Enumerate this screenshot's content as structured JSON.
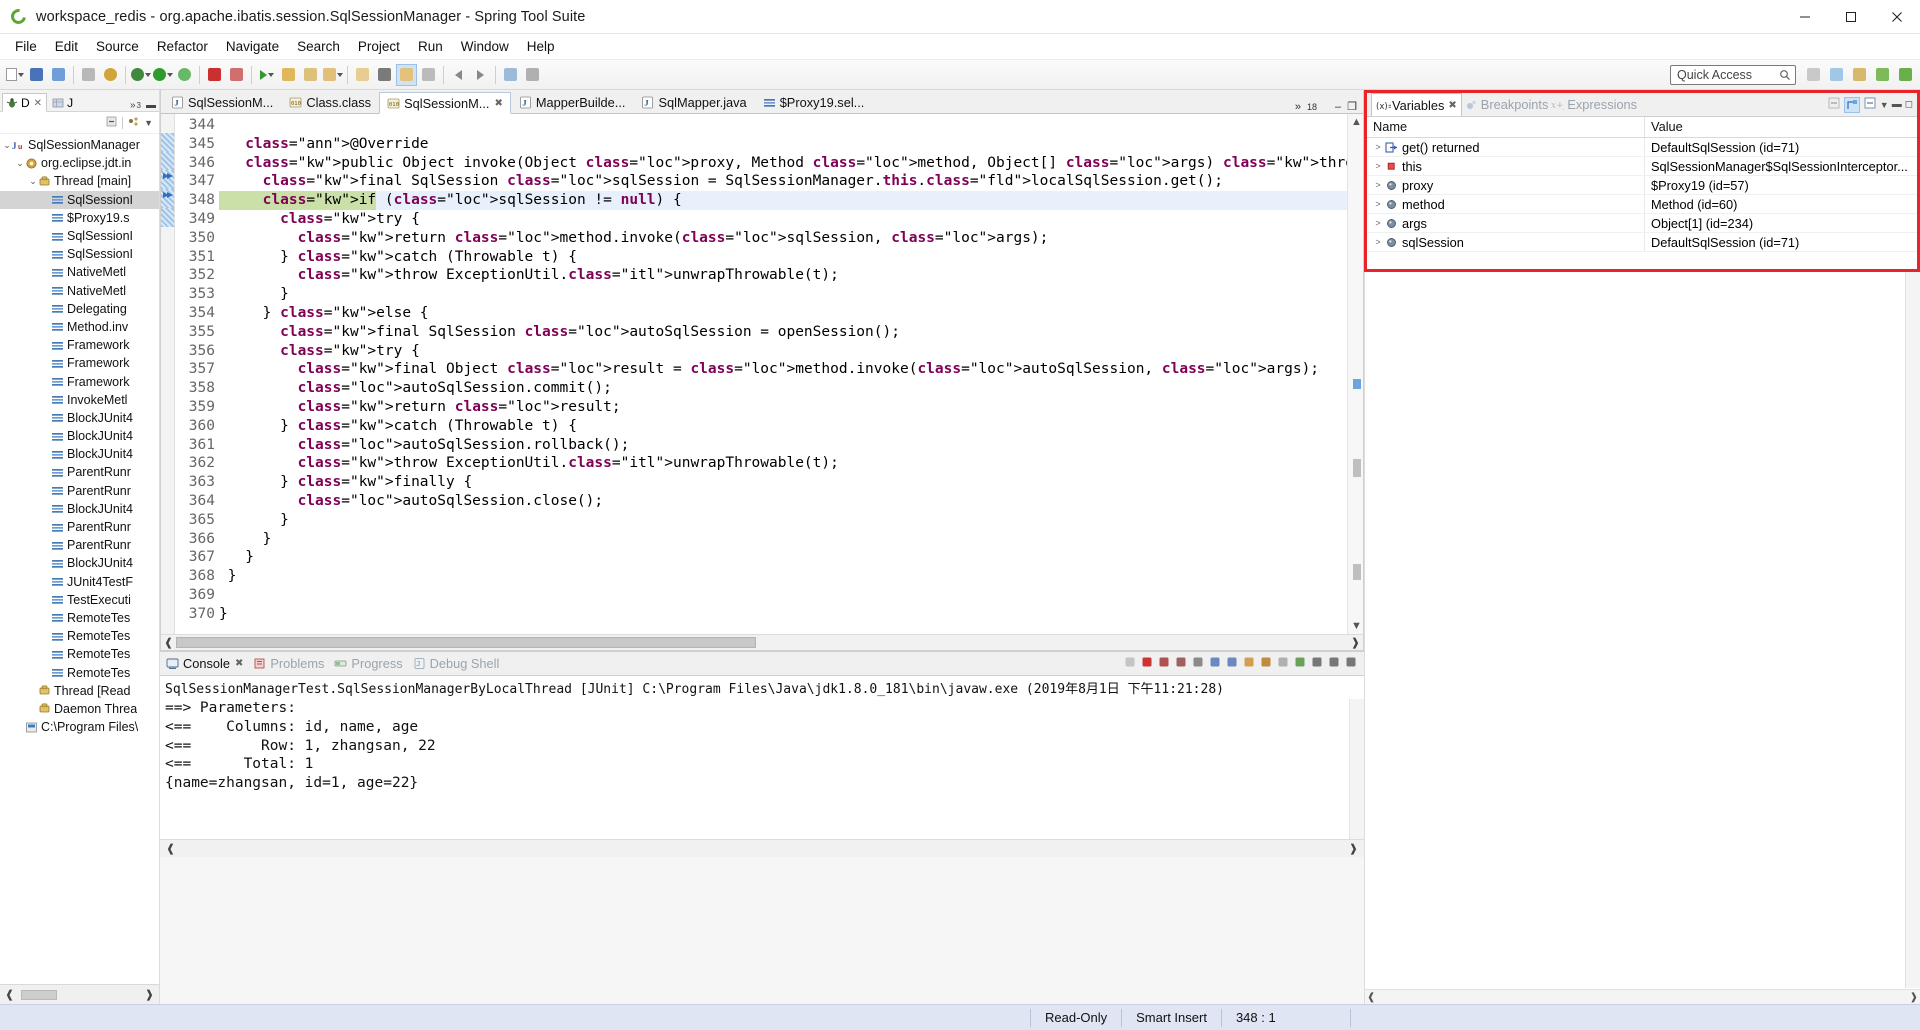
{
  "window": {
    "title": "workspace_redis - org.apache.ibatis.session.SqlSessionManager - Spring Tool Suite",
    "app_icon": "sts-icon",
    "minimize": "–",
    "maximize": "□",
    "close": "✕"
  },
  "menu": {
    "items": [
      "File",
      "Edit",
      "Source",
      "Refactor",
      "Navigate",
      "Search",
      "Project",
      "Run",
      "Window",
      "Help"
    ]
  },
  "toolbar": {
    "quick_access_placeholder": "Quick Access",
    "quick_access_value": ""
  },
  "debug_view": {
    "tab_label": "D",
    "tab_close": "✕",
    "secondary_tab": "J",
    "overflow": "»",
    "overflow_count": "3",
    "tree": [
      {
        "indent": 0,
        "twisty": "⌄",
        "icon": "junit-icon",
        "label": "SqlSessionManager",
        "selected": false
      },
      {
        "indent": 1,
        "twisty": "⌄",
        "icon": "process-icon",
        "label": "org.eclipse.jdt.in",
        "selected": false
      },
      {
        "indent": 2,
        "twisty": "⌄",
        "icon": "thread-icon",
        "label": "Thread [main]",
        "selected": false
      },
      {
        "indent": 3,
        "twisty": "",
        "icon": "stackframe-icon",
        "label": "SqlSessionI",
        "selected": true
      },
      {
        "indent": 3,
        "twisty": "",
        "icon": "stackframe-icon",
        "label": "$Proxy19.s",
        "selected": false
      },
      {
        "indent": 3,
        "twisty": "",
        "icon": "stackframe-icon",
        "label": "SqlSessionI",
        "selected": false
      },
      {
        "indent": 3,
        "twisty": "",
        "icon": "stackframe-icon",
        "label": "SqlSessionI",
        "selected": false
      },
      {
        "indent": 3,
        "twisty": "",
        "icon": "stackframe-icon",
        "label": "NativeMetl",
        "selected": false
      },
      {
        "indent": 3,
        "twisty": "",
        "icon": "stackframe-icon",
        "label": "NativeMetl",
        "selected": false
      },
      {
        "indent": 3,
        "twisty": "",
        "icon": "stackframe-icon",
        "label": "Delegating",
        "selected": false
      },
      {
        "indent": 3,
        "twisty": "",
        "icon": "stackframe-icon",
        "label": "Method.inv",
        "selected": false
      },
      {
        "indent": 3,
        "twisty": "",
        "icon": "stackframe-icon",
        "label": "Framework",
        "selected": false
      },
      {
        "indent": 3,
        "twisty": "",
        "icon": "stackframe-icon",
        "label": "Framework",
        "selected": false
      },
      {
        "indent": 3,
        "twisty": "",
        "icon": "stackframe-icon",
        "label": "Framework",
        "selected": false
      },
      {
        "indent": 3,
        "twisty": "",
        "icon": "stackframe-icon",
        "label": "InvokeMetl",
        "selected": false
      },
      {
        "indent": 3,
        "twisty": "",
        "icon": "stackframe-icon",
        "label": "BlockJUnit4",
        "selected": false
      },
      {
        "indent": 3,
        "twisty": "",
        "icon": "stackframe-icon",
        "label": "BlockJUnit4",
        "selected": false
      },
      {
        "indent": 3,
        "twisty": "",
        "icon": "stackframe-icon",
        "label": "BlockJUnit4",
        "selected": false
      },
      {
        "indent": 3,
        "twisty": "",
        "icon": "stackframe-icon",
        "label": "ParentRunr",
        "selected": false
      },
      {
        "indent": 3,
        "twisty": "",
        "icon": "stackframe-icon",
        "label": "ParentRunr",
        "selected": false
      },
      {
        "indent": 3,
        "twisty": "",
        "icon": "stackframe-icon",
        "label": "BlockJUnit4",
        "selected": false
      },
      {
        "indent": 3,
        "twisty": "",
        "icon": "stackframe-icon",
        "label": "ParentRunr",
        "selected": false
      },
      {
        "indent": 3,
        "twisty": "",
        "icon": "stackframe-icon",
        "label": "ParentRunr",
        "selected": false
      },
      {
        "indent": 3,
        "twisty": "",
        "icon": "stackframe-icon",
        "label": "BlockJUnit4",
        "selected": false
      },
      {
        "indent": 3,
        "twisty": "",
        "icon": "stackframe-icon",
        "label": "JUnit4TestF",
        "selected": false
      },
      {
        "indent": 3,
        "twisty": "",
        "icon": "stackframe-icon",
        "label": "TestExecuti",
        "selected": false
      },
      {
        "indent": 3,
        "twisty": "",
        "icon": "stackframe-icon",
        "label": "RemoteTes",
        "selected": false
      },
      {
        "indent": 3,
        "twisty": "",
        "icon": "stackframe-icon",
        "label": "RemoteTes",
        "selected": false
      },
      {
        "indent": 3,
        "twisty": "",
        "icon": "stackframe-icon",
        "label": "RemoteTes",
        "selected": false
      },
      {
        "indent": 3,
        "twisty": "",
        "icon": "stackframe-icon",
        "label": "RemoteTes",
        "selected": false
      },
      {
        "indent": 2,
        "twisty": "",
        "icon": "thread-icon",
        "label": "Thread [Read",
        "selected": false
      },
      {
        "indent": 2,
        "twisty": "",
        "icon": "thread-icon",
        "label": "Daemon Threa",
        "selected": false
      },
      {
        "indent": 1,
        "twisty": "",
        "icon": "exe-icon",
        "label": "C:\\Program Files\\",
        "selected": false
      }
    ]
  },
  "editor": {
    "tabs": [
      {
        "label": "SqlSessionM...",
        "icon": "java-icon",
        "state": "inactive",
        "closable": false
      },
      {
        "label": "Class.class",
        "icon": "class-icon",
        "state": "inactive",
        "closable": false
      },
      {
        "label": "SqlSessionM...",
        "icon": "class-icon",
        "state": "active",
        "closable": true
      },
      {
        "label": "MapperBuilde...",
        "icon": "java-icon",
        "state": "inactive",
        "closable": false
      },
      {
        "label": "SqlMapper.java",
        "icon": "java-icon",
        "state": "inactive",
        "closable": false
      },
      {
        "label": "$Proxy19.sel...",
        "icon": "stack-icon",
        "state": "inactive",
        "closable": false
      }
    ],
    "overflow_marker": "»",
    "overflow_count": "18",
    "minimize_icon": "–",
    "maximize_icon": "❐",
    "first_line_number": 344,
    "current_line": 348,
    "lines": [
      {
        "n": 344,
        "text": "",
        "marker": "",
        "fold": ""
      },
      {
        "n": 345,
        "text": "   @Override",
        "marker": "bp-range",
        "fold": "collapse"
      },
      {
        "n": 346,
        "text": "   public Object invoke(Object proxy, Method method, Object[] args) throws Throwable {",
        "marker": "bp-range-arrow",
        "fold": ""
      },
      {
        "n": 347,
        "text": "     final SqlSession sqlSession = SqlSessionManager.this.localSqlSession.get();",
        "marker": "step",
        "fold": ""
      },
      {
        "n": 348,
        "text": "     if (sqlSession != null) {",
        "marker": "step",
        "fold": "",
        "exec": true
      },
      {
        "n": 349,
        "text": "       try {",
        "marker": "bp-range",
        "fold": ""
      },
      {
        "n": 350,
        "text": "         return method.invoke(sqlSession, args);",
        "marker": "",
        "fold": ""
      },
      {
        "n": 351,
        "text": "       } catch (Throwable t) {",
        "marker": "",
        "fold": ""
      },
      {
        "n": 352,
        "text": "         throw ExceptionUtil.unwrapThrowable(t);",
        "marker": "",
        "fold": ""
      },
      {
        "n": 353,
        "text": "       }",
        "marker": "",
        "fold": ""
      },
      {
        "n": 354,
        "text": "     } else {",
        "marker": "",
        "fold": ""
      },
      {
        "n": 355,
        "text": "       final SqlSession autoSqlSession = openSession();",
        "marker": "",
        "fold": "collapse"
      },
      {
        "n": 356,
        "text": "       try {",
        "marker": "",
        "fold": ""
      },
      {
        "n": 357,
        "text": "         final Object result = method.invoke(autoSqlSession, args);",
        "marker": "",
        "fold": ""
      },
      {
        "n": 358,
        "text": "         autoSqlSession.commit();",
        "marker": "",
        "fold": ""
      },
      {
        "n": 359,
        "text": "         return result;",
        "marker": "",
        "fold": ""
      },
      {
        "n": 360,
        "text": "       } catch (Throwable t) {",
        "marker": "",
        "fold": ""
      },
      {
        "n": 361,
        "text": "         autoSqlSession.rollback();",
        "marker": "",
        "fold": ""
      },
      {
        "n": 362,
        "text": "         throw ExceptionUtil.unwrapThrowable(t);",
        "marker": "",
        "fold": ""
      },
      {
        "n": 363,
        "text": "       } finally {",
        "marker": "",
        "fold": ""
      },
      {
        "n": 364,
        "text": "         autoSqlSession.close();",
        "marker": "",
        "fold": ""
      },
      {
        "n": 365,
        "text": "       }",
        "marker": "",
        "fold": ""
      },
      {
        "n": 366,
        "text": "     }",
        "marker": "",
        "fold": ""
      },
      {
        "n": 367,
        "text": "   }",
        "marker": "",
        "fold": ""
      },
      {
        "n": 368,
        "text": " }",
        "marker": "",
        "fold": ""
      },
      {
        "n": 369,
        "text": "",
        "marker": "",
        "fold": ""
      },
      {
        "n": 370,
        "text": "}",
        "marker": "",
        "fold": ""
      }
    ]
  },
  "variables_view": {
    "tabs": [
      {
        "label": "Variables",
        "state": "active",
        "icon": "variables-icon",
        "closable": true
      },
      {
        "label": "Breakpoints",
        "state": "inactive",
        "icon": "breakpoint-icon",
        "closable": false
      },
      {
        "label": "Expressions",
        "state": "inactive",
        "icon": "expressions-icon",
        "closable": false
      }
    ],
    "close_icon": "✕",
    "columns": [
      "Name",
      "Value"
    ],
    "rows": [
      {
        "twisty": ">",
        "icon": "return-value-icon",
        "name": "get() returned",
        "value": "DefaultSqlSession  (id=71)"
      },
      {
        "twisty": ">",
        "icon": "this-icon",
        "name": "this",
        "value": "SqlSessionManager$SqlSessionInterceptor..."
      },
      {
        "twisty": ">",
        "icon": "local-var-icon",
        "name": "proxy",
        "value": "$Proxy19  (id=57)"
      },
      {
        "twisty": ">",
        "icon": "local-var-icon",
        "name": "method",
        "value": "Method  (id=60)"
      },
      {
        "twisty": ">",
        "icon": "local-var-icon",
        "name": "args",
        "value": "Object[1]  (id=234)"
      },
      {
        "twisty": ">",
        "icon": "local-var-icon",
        "name": "sqlSession",
        "value": "DefaultSqlSession  (id=71)"
      }
    ],
    "highlight_color": "#e8232a"
  },
  "console_view": {
    "tabs": [
      {
        "label": "Console",
        "state": "active",
        "icon": "console-icon",
        "closable": true
      },
      {
        "label": "Problems",
        "state": "inactive",
        "icon": "problems-icon",
        "closable": false
      },
      {
        "label": "Progress",
        "state": "inactive",
        "icon": "progress-icon",
        "closable": false
      },
      {
        "label": "Debug Shell",
        "state": "inactive",
        "icon": "debug-shell-icon",
        "closable": false
      }
    ],
    "close_icon": "✕",
    "launch_header": "SqlSessionManagerTest.SqlSessionManagerByLocalThread [JUnit] C:\\Program Files\\Java\\jdk1.8.0_181\\bin\\javaw.exe (2019年8月1日 下午11:21:28)",
    "output": [
      "==> Parameters: ",
      "<==    Columns: id, name, age",
      "<==        Row: 1, zhangsan, 22",
      "<==      Total: 1",
      "{name=zhangsan, id=1, age=22}"
    ]
  },
  "statusbar": {
    "readonly": "Read-Only",
    "insert_mode": "Smart Insert",
    "caret_position": "348 : 1"
  }
}
